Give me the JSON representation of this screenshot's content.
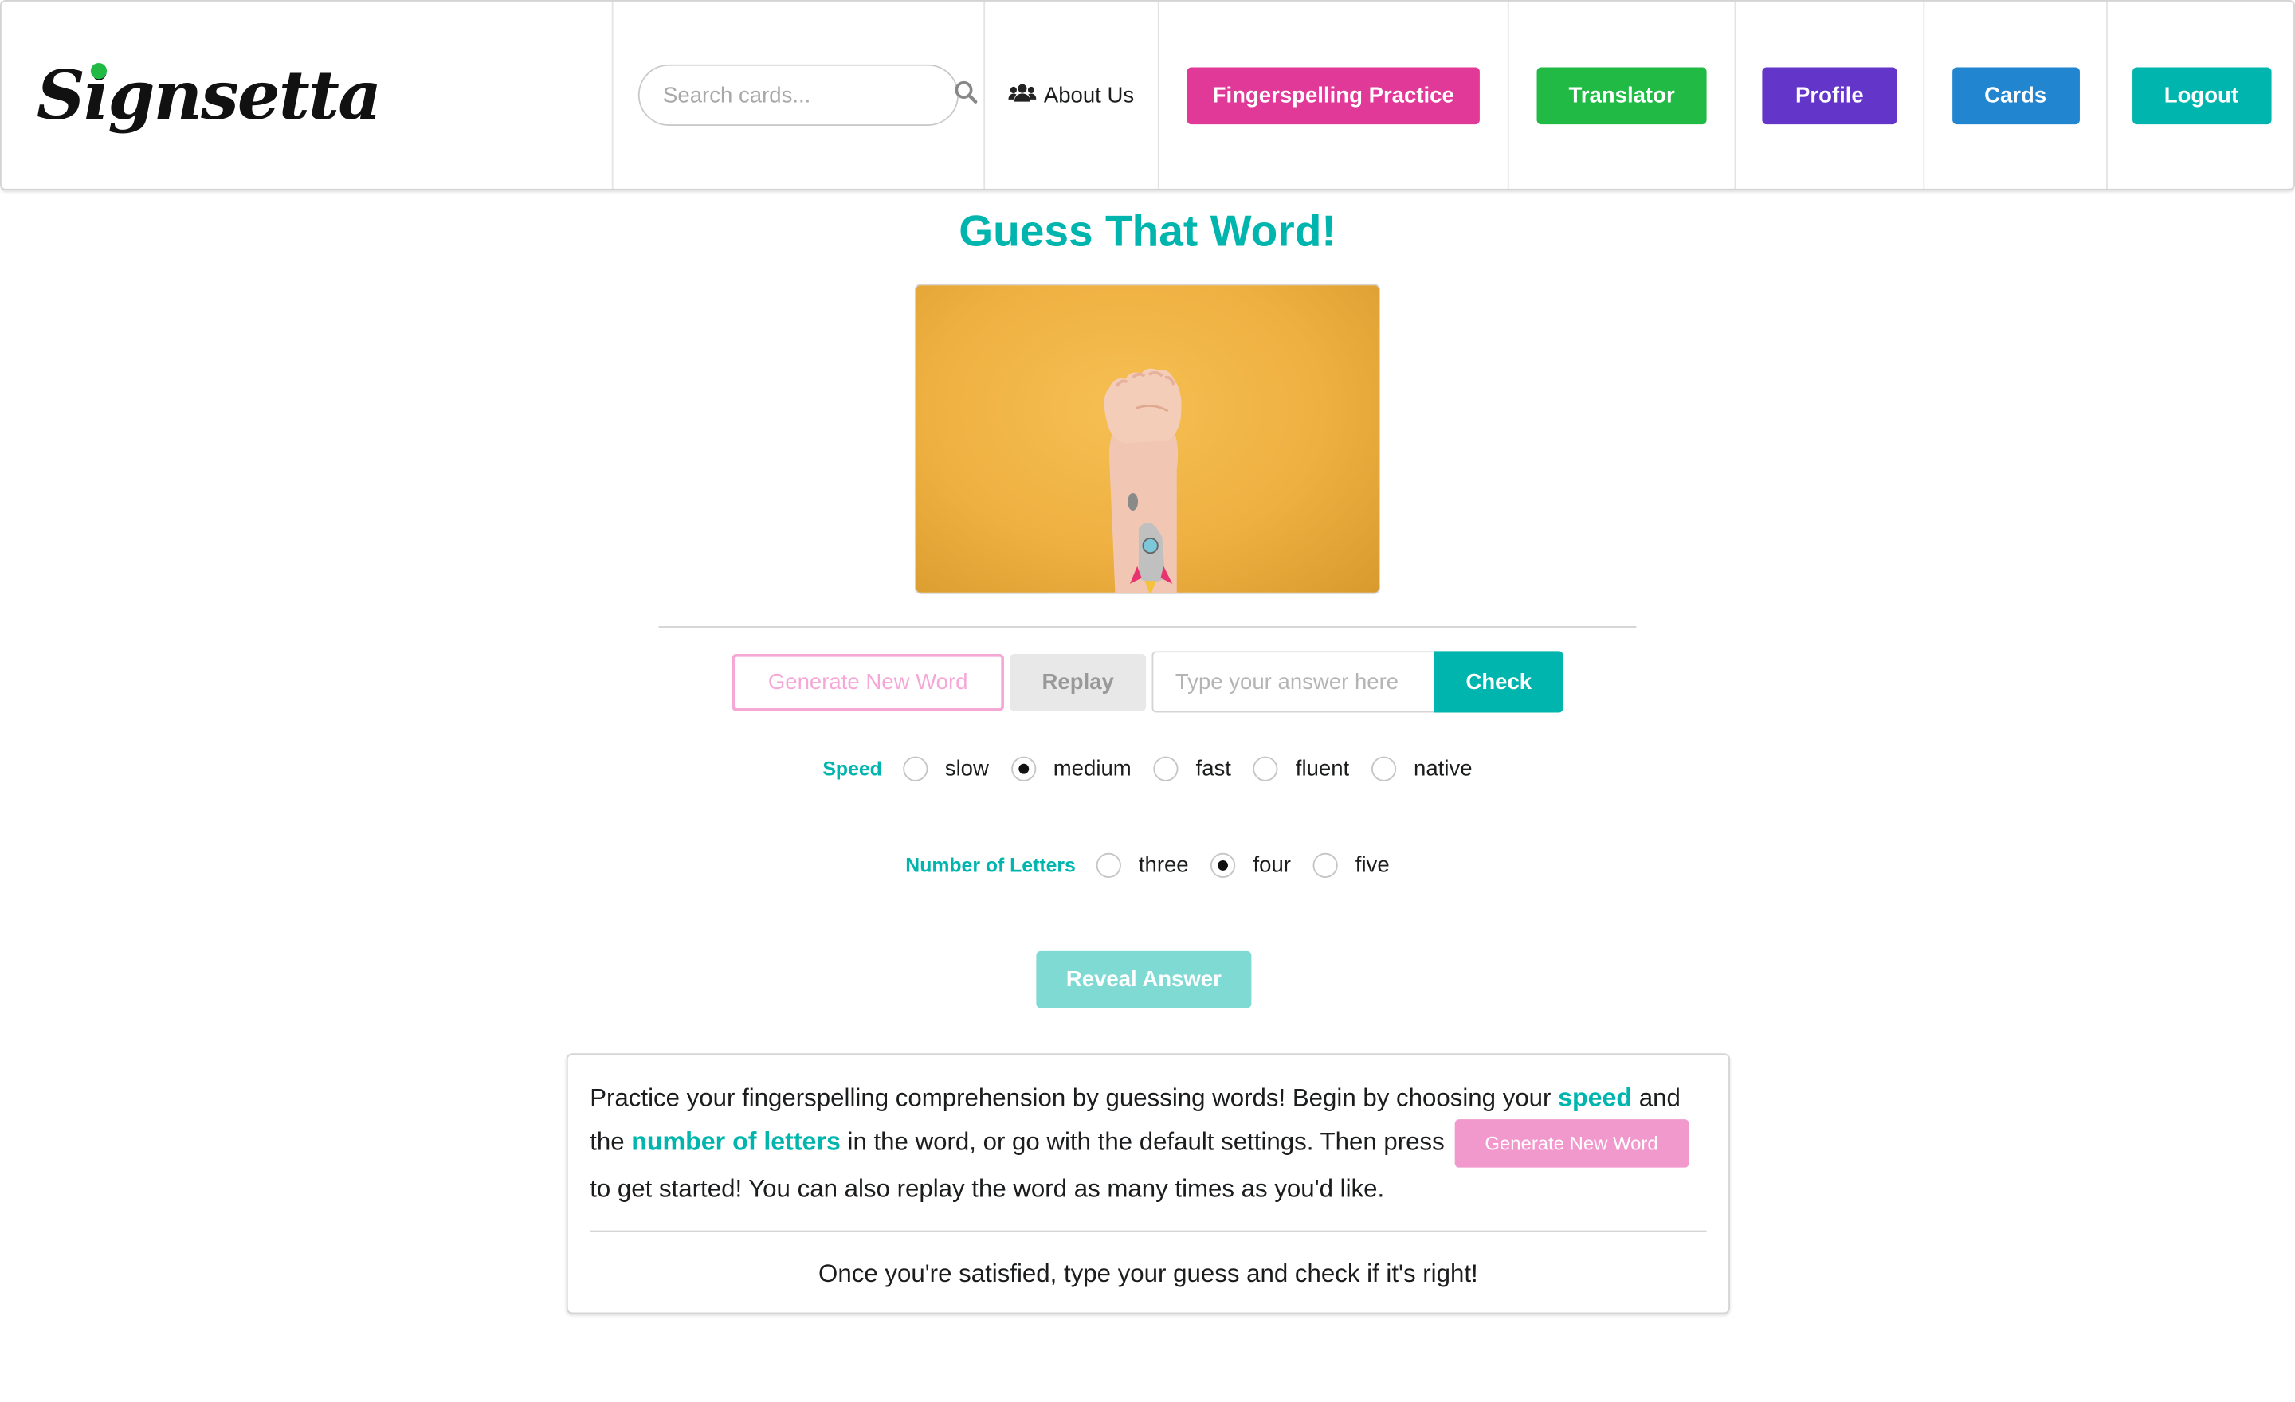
{
  "brand": {
    "logo_text": "Signsetta"
  },
  "search": {
    "placeholder": "Search cards..."
  },
  "nav": {
    "about": "About Us",
    "fingerspelling": "Fingerspelling Practice",
    "translator": "Translator",
    "profile": "Profile",
    "cards": "Cards",
    "logout": "Logout"
  },
  "main": {
    "title": "Guess That Word!",
    "generate": "Generate New Word",
    "replay": "Replay",
    "answer_placeholder": "Type your answer here",
    "check": "Check",
    "reveal": "Reveal Answer"
  },
  "speed": {
    "label": "Speed",
    "options": [
      "slow",
      "medium",
      "fast",
      "fluent",
      "native"
    ],
    "selected": "medium"
  },
  "letters": {
    "label": "Number of Letters",
    "options": [
      "three",
      "four",
      "five"
    ],
    "selected": "four"
  },
  "info": {
    "t1": "Practice your fingerspelling comprehension by guessing words! Begin by choosing your ",
    "hl1": "speed",
    "t2": " and the ",
    "hl2": "number of letters",
    "t3": " in the word, or go with the default settings. Then press ",
    "button": "Generate New Word",
    "t4": " to get started! You can also replay the word as many times as you'd like.",
    "footer": "Once you're satisfied, type your guess and check if it's right!"
  },
  "colors": {
    "teal": "#00b5ad",
    "pink": "#e03997",
    "green": "#21ba45",
    "violet": "#6435c9",
    "blue": "#2185d0",
    "photo_background": "#eeb041"
  },
  "icons": {
    "search": "search-icon",
    "about": "users-icon",
    "media": "hand-sign-photo"
  }
}
